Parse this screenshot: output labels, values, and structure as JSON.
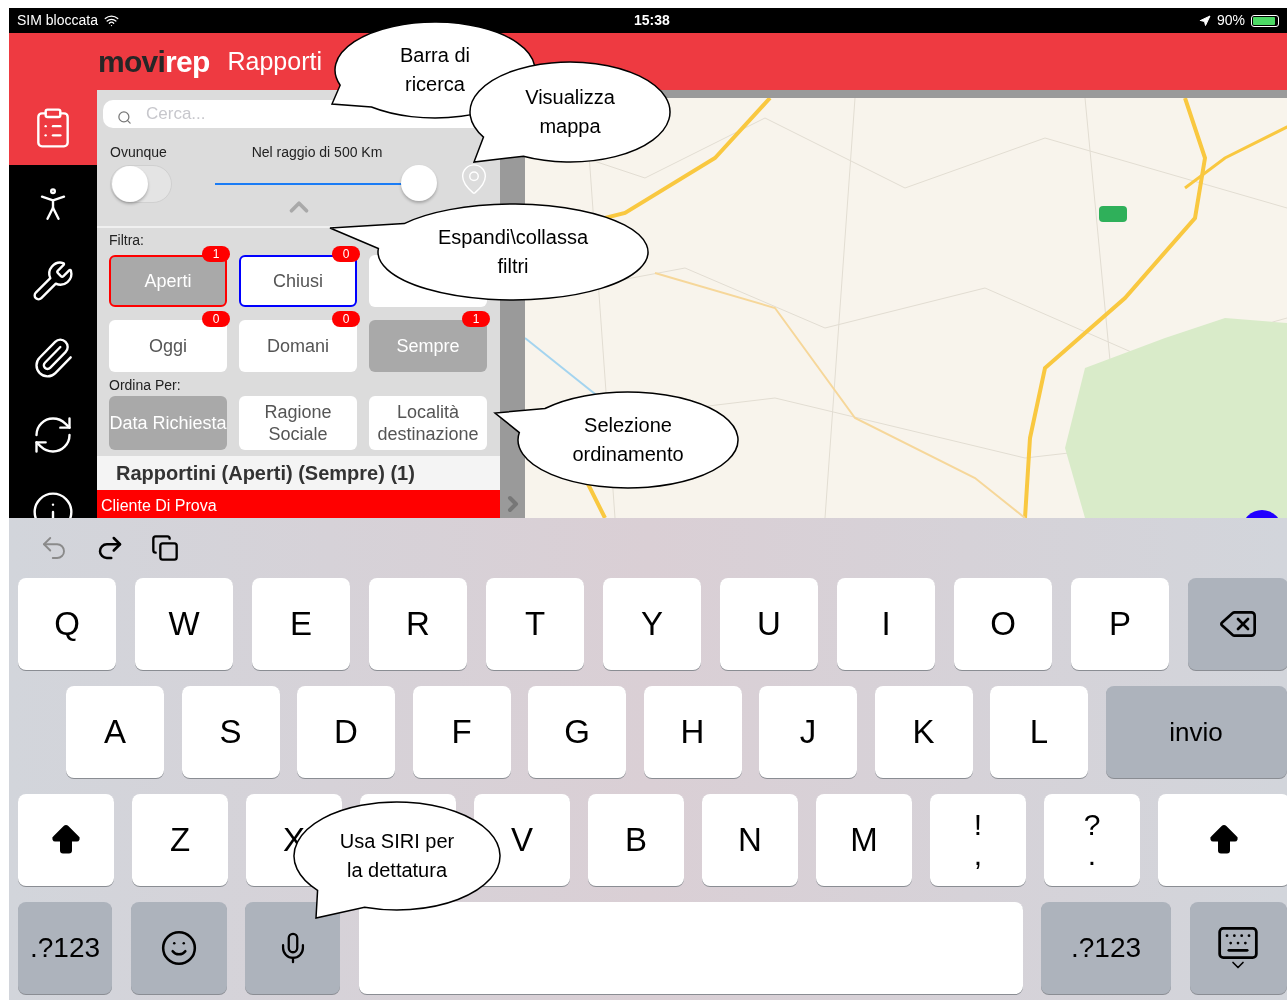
{
  "status_bar": {
    "carrier": "SIM bloccata",
    "time": "15:38",
    "battery": "90%"
  },
  "header": {
    "logo_dark": "movi",
    "logo_light": "rep",
    "title": "Rapporti"
  },
  "sidebar": {
    "items": [
      {
        "kind": "report",
        "selected": true
      },
      {
        "kind": "person",
        "selected": false
      },
      {
        "kind": "tools",
        "selected": false
      },
      {
        "kind": "attachment",
        "selected": false
      },
      {
        "kind": "sync",
        "selected": false
      },
      {
        "kind": "info",
        "selected": false
      }
    ]
  },
  "search": {
    "placeholder": "Cerca..."
  },
  "location": {
    "toggle_label": "Ovunque",
    "on": false,
    "radius_label": "Nel raggio di 500 Km",
    "level": 1
  },
  "filters": {
    "label": "Filtra:",
    "buttons": [
      {
        "label": "Aperti",
        "count": "1",
        "selected": true,
        "color": "#ff0000"
      },
      {
        "label": "Chiusi",
        "count": "0",
        "selected": false,
        "color": "#0000ff"
      },
      {
        "selected": false
      },
      {
        "label": "Oggi",
        "count": "0",
        "selected": false
      },
      {
        "label": "Domani",
        "count": "0",
        "selected": false
      },
      {
        "label": "Sempre",
        "count": "1",
        "selected": true
      }
    ]
  },
  "sort": {
    "label": "Ordina Per:",
    "buttons": [
      {
        "label": "Data Richiesta",
        "selected": true
      },
      {
        "label": "Ragione Sociale",
        "selected": false
      },
      {
        "label": "Località destinazione",
        "selected": false
      }
    ]
  },
  "list": {
    "title": "Rapportini (Aperti) (Sempre) (1)",
    "items": [
      {
        "label": "Cliente Di Prova",
        "selected": true
      }
    ]
  },
  "keyboard": {
    "rows": [
      {
        "keys": [
          {
            "kind": "letter",
            "label": "Q"
          },
          {
            "kind": "letter",
            "label": "W"
          },
          {
            "kind": "letter",
            "label": "E"
          },
          {
            "kind": "letter",
            "label": "R"
          },
          {
            "kind": "letter",
            "label": "T"
          },
          {
            "kind": "letter",
            "label": "Y"
          },
          {
            "kind": "letter",
            "label": "U"
          },
          {
            "kind": "letter",
            "label": "I"
          },
          {
            "kind": "letter",
            "label": "O"
          },
          {
            "kind": "letter",
            "label": "P"
          },
          {
            "kind": "backspace"
          }
        ]
      },
      {
        "keys": [
          {
            "kind": "letter",
            "label": "A"
          },
          {
            "kind": "letter",
            "label": "S"
          },
          {
            "kind": "letter",
            "label": "D"
          },
          {
            "kind": "letter",
            "label": "F"
          },
          {
            "kind": "letter",
            "label": "G"
          },
          {
            "kind": "letter",
            "label": "H"
          },
          {
            "kind": "letter",
            "label": "J"
          },
          {
            "kind": "letter",
            "label": "K"
          },
          {
            "kind": "letter",
            "label": "L"
          },
          {
            "kind": "return",
            "label": "invio"
          }
        ]
      },
      {
        "keys": [
          {
            "kind": "shift"
          },
          {
            "kind": "letter",
            "label": "Z"
          },
          {
            "kind": "letter",
            "label": "X"
          },
          {
            "kind": "letter"
          },
          {
            "kind": "letter",
            "label": "V"
          },
          {
            "kind": "letter",
            "label": "B"
          },
          {
            "kind": "letter",
            "label": "N"
          },
          {
            "kind": "letter",
            "label": "M"
          },
          {
            "kind": "dual",
            "label": "!",
            "sub": ","
          },
          {
            "kind": "dual",
            "label": "?",
            "sub": "."
          },
          {
            "kind": "shift"
          }
        ]
      },
      {
        "keys": [
          {
            "kind": "mode",
            "label": ".?123"
          },
          {
            "kind": "emoji"
          },
          {
            "kind": "mic"
          },
          {
            "kind": "space"
          },
          {
            "kind": "mode",
            "label": ".?123"
          },
          {
            "kind": "hide"
          }
        ]
      }
    ]
  },
  "callouts": [
    {
      "text": "Barra di ricerca"
    },
    {
      "text": "Visualizza mappa"
    },
    {
      "text": "Espandi\\collassa filtri"
    },
    {
      "text": "Selezione ordinamento"
    },
    {
      "text": "Usa SIRI per la dettatura"
    }
  ]
}
